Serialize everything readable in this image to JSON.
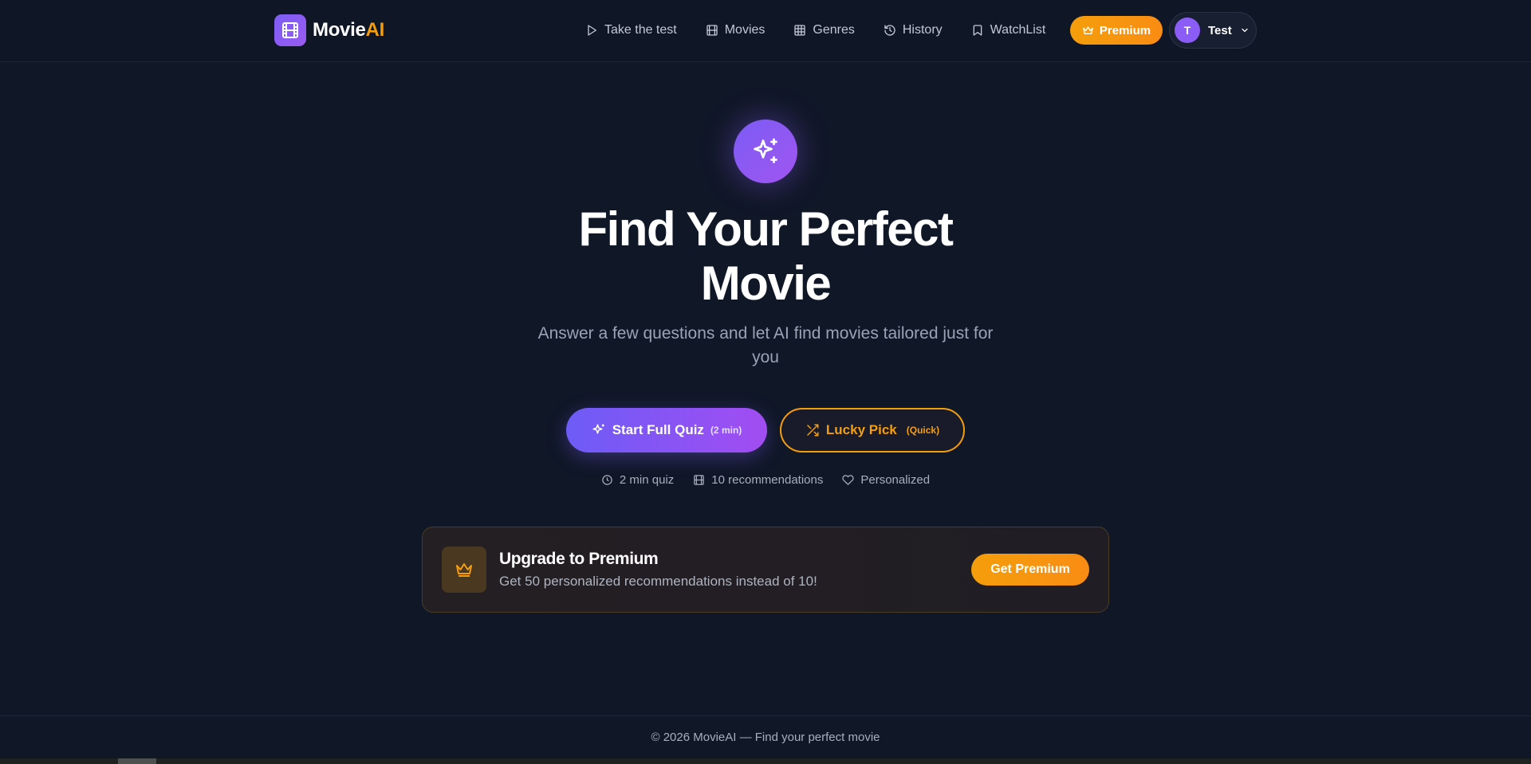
{
  "app": {
    "logo_main": "Movie",
    "logo_accent": "AI",
    "brand_color": "#8b5cf6",
    "accent_color": "#f59e0b"
  },
  "nav": {
    "items": [
      {
        "label": "Take the test",
        "icon": "play-icon"
      },
      {
        "label": "Movies",
        "icon": "film-icon"
      },
      {
        "label": "Genres",
        "icon": "grid-icon"
      },
      {
        "label": "History",
        "icon": "history-icon"
      },
      {
        "label": "WatchList",
        "icon": "bookmark-icon"
      }
    ],
    "premium_label": "Premium"
  },
  "user": {
    "initial": "T",
    "name": "Test"
  },
  "hero": {
    "title": "Find Your Perfect Movie",
    "subtitle": "Answer a few questions and let AI find movies tailored just for you",
    "quiz_button": "Start Full Quiz",
    "quiz_duration": "(2 min)",
    "lucky_button": "Lucky Pick",
    "lucky_note": "(Quick)",
    "features": [
      {
        "label": "2 min quiz",
        "icon": "clock-icon"
      },
      {
        "label": "10 recommendations",
        "icon": "film-icon"
      },
      {
        "label": "Personalized",
        "icon": "heart-icon"
      }
    ]
  },
  "upgrade": {
    "title": "Upgrade to Premium",
    "subtitle": "Get 50 personalized recommendations instead of 10!",
    "button": "Get Premium"
  },
  "footer": {
    "text": "© 2026 MovieAI — Find your perfect movie"
  }
}
